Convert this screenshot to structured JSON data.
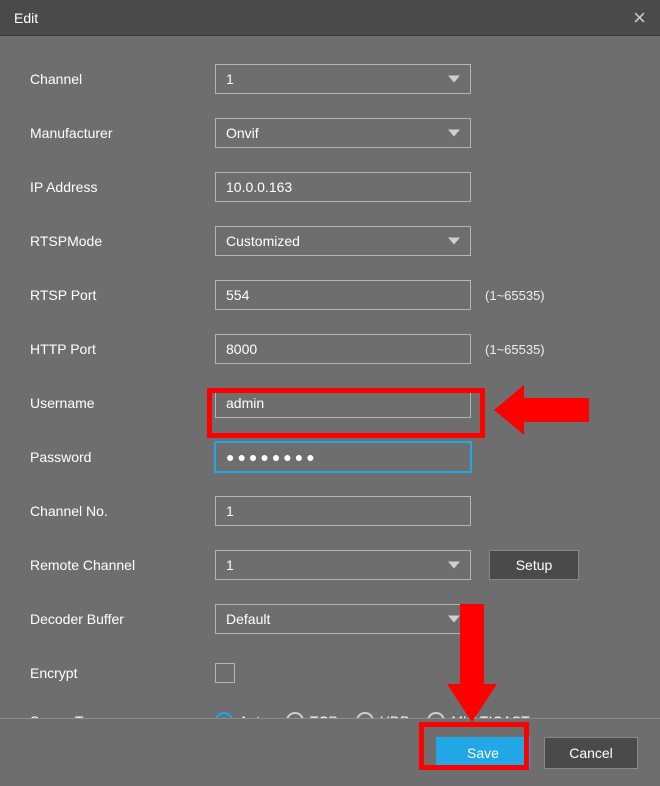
{
  "title": "Edit",
  "fields": {
    "channel": {
      "label": "Channel",
      "value": "1"
    },
    "manufacturer": {
      "label": "Manufacturer",
      "value": "Onvif"
    },
    "ip": {
      "label": "IP Address",
      "value": "10.0.0.163"
    },
    "rtsp_mode": {
      "label": "RTSPMode",
      "value": "Customized"
    },
    "rtsp_port": {
      "label": "RTSP Port",
      "value": "554",
      "hint": "(1~65535)"
    },
    "http_port": {
      "label": "HTTP Port",
      "value": "8000",
      "hint": "(1~65535)"
    },
    "username": {
      "label": "Username",
      "value": "admin"
    },
    "password": {
      "label": "Password",
      "value": "●●●●●●●●"
    },
    "channel_no": {
      "label": "Channel No.",
      "value": "1"
    },
    "remote_channel": {
      "label": "Remote Channel",
      "value": "1",
      "setup": "Setup"
    },
    "decoder_buffer": {
      "label": "Decoder Buffer",
      "value": "Default"
    },
    "encrypt": {
      "label": "Encrypt",
      "checked": false
    },
    "server_type": {
      "label": "Server Type",
      "options": [
        "Auto",
        "TCP",
        "UDP",
        "MULTICAST"
      ],
      "selected": "Auto"
    }
  },
  "buttons": {
    "save": "Save",
    "cancel": "Cancel"
  }
}
